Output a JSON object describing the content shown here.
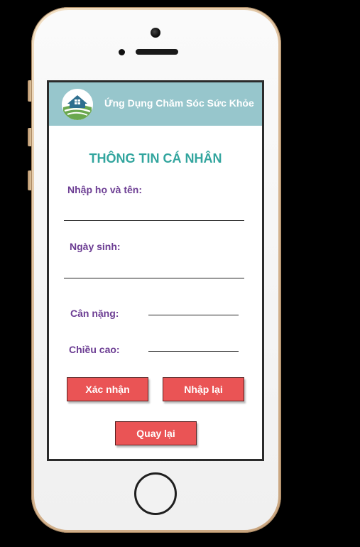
{
  "app": {
    "title": "Ứng Dụng Chăm Sóc Sức Khỏe",
    "logo_icon": "house-health-logo-icon"
  },
  "form": {
    "title": "THÔNG TIN CÁ NHÂN",
    "fields": {
      "fullname_label": "Nhập họ và tên:",
      "birthdate_label": "Ngày sinh:",
      "weight_label": "Cân nặng:",
      "height_label": "Chiều cao:"
    },
    "buttons": {
      "confirm": "Xác nhận",
      "reset": "Nhập lại",
      "back": "Quay lại"
    }
  },
  "colors": {
    "header_bg": "#97c6cc",
    "title_teal": "#32a59e",
    "label_purple": "#6c3d93",
    "button_red": "#ea5455"
  }
}
